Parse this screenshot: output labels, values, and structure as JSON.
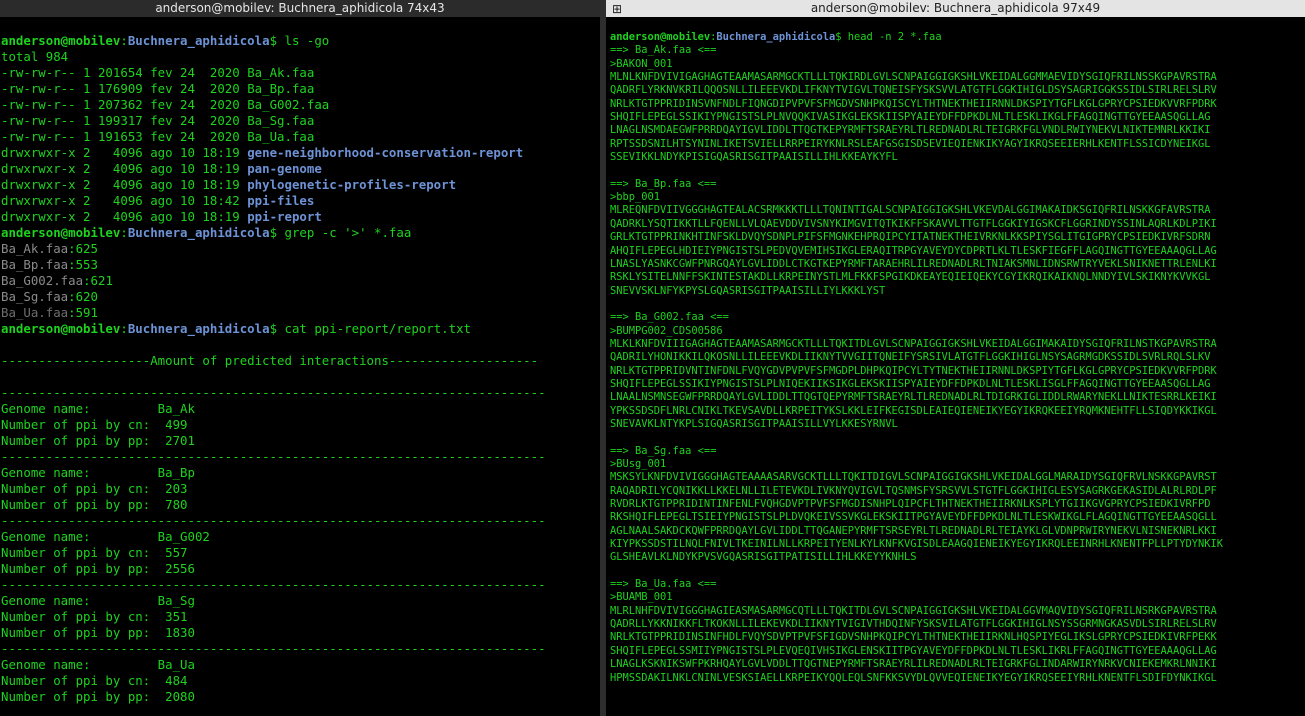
{
  "left_window": {
    "title": "anderson@mobilev: Buchnera_aphidicola 74x43",
    "prompt": {
      "user": "anderson@mobilev",
      "path": "Buchnera_aphidicola",
      "symbol": "$ "
    },
    "cmd1": "ls -go",
    "total": "total 984",
    "files": [
      {
        "meta": "-rw-rw-r-- 1 201654 fev 24  2020 ",
        "name": "Ba_Ak.faa"
      },
      {
        "meta": "-rw-rw-r-- 1 176909 fev 24  2020 ",
        "name": "Ba_Bp.faa"
      },
      {
        "meta": "-rw-rw-r-- 1 207362 fev 24  2020 ",
        "name": "Ba_G002.faa"
      },
      {
        "meta": "-rw-rw-r-- 1 199317 fev 24  2020 ",
        "name": "Ba_Sg.faa"
      },
      {
        "meta": "-rw-rw-r-- 1 191653 fev 24  2020 ",
        "name": "Ba_Ua.faa"
      }
    ],
    "dirs": [
      {
        "meta": "drwxrwxr-x 2   4096 ago 10 18:19 ",
        "name": "gene-neighborhood-conservation-report"
      },
      {
        "meta": "drwxrwxr-x 2   4096 ago 10 18:19 ",
        "name": "pan-genome"
      },
      {
        "meta": "drwxrwxr-x 2   4096 ago 10 18:19 ",
        "name": "phylogenetic-profiles-report"
      },
      {
        "meta": "drwxrwxr-x 2   4096 ago 10 18:42 ",
        "name": "ppi-files"
      },
      {
        "meta": "drwxrwxr-x 2   4096 ago 10 18:19 ",
        "name": "ppi-report"
      }
    ],
    "cmd2": "grep -c '>' *.faa",
    "counts": [
      {
        "file": "Ba_Ak.faa",
        "count": ":625"
      },
      {
        "file": "Ba_Bp.faa",
        "count": ":553"
      },
      {
        "file": "Ba_G002.faa",
        "count": ":621"
      },
      {
        "file": "Ba_Sg.faa",
        "count": ":620"
      },
      {
        "file": "Ba_Ua.faa",
        "count": ":591"
      }
    ],
    "cmd3": "cat ppi-report/report.txt",
    "report_header": "--------------------Amount of predicted interactions--------------------",
    "dash_rule": "-------------------------------------------------------------------------",
    "report": [
      {
        "genome_label": "Genome name:         ",
        "genome": "Ba_Ak",
        "cn_label": "Number of ppi by cn:  ",
        "cn": "499",
        "pp_label": "Number of ppi by pp:  ",
        "pp": "2701"
      },
      {
        "genome_label": "Genome name:         ",
        "genome": "Ba_Bp",
        "cn_label": "Number of ppi by cn:  ",
        "cn": "203",
        "pp_label": "Number of ppi by pp:  ",
        "pp": "780"
      },
      {
        "genome_label": "Genome name:         ",
        "genome": "Ba_G002",
        "cn_label": "Number of ppi by cn:  ",
        "cn": "557",
        "pp_label": "Number of ppi by pp:  ",
        "pp": "2556"
      },
      {
        "genome_label": "Genome name:         ",
        "genome": "Ba_Sg",
        "cn_label": "Number of ppi by cn:  ",
        "cn": "351",
        "pp_label": "Number of ppi by pp:  ",
        "pp": "1830"
      },
      {
        "genome_label": "Genome name:         ",
        "genome": "Ba_Ua",
        "cn_label": "Number of ppi by cn:  ",
        "cn": "484",
        "pp_label": "Number of ppi by pp:  ",
        "pp": "2080"
      }
    ]
  },
  "right_window": {
    "title": "anderson@mobilev: Buchnera_aphidicola 97x49",
    "icon": "terminal-icon",
    "prompt": {
      "user": "anderson@mobilev",
      "path": "Buchnera_aphidicola",
      "symbol": "$ "
    },
    "cmd": "head -n 2 *.faa",
    "blocks": [
      {
        "header": "==> Ba_Ak.faa <==",
        "id": ">BAKON_001",
        "seq": [
          "MLNLKNFDVIVIGAGHAGTEAAMASARMGCKTLLLTQKIRDLGVLSCNPAIGGIGKSHLVKEIDALGGMMAEVIDYSGIQFRILNSSKGPAVRSTRA",
          "QADRFLYRKNVKRILQQOSNLLILEEEVKDLIFKNYTVIGVLTQNEISFYSKSVVLATGTFLGGKIHIGLDSYSAGRIGGKSSIDLSIRLRELSLRV",
          "NRLKTGTPPRIDINSVNFNDLFIQNGDIPVPVFSFMGDVSNHPKQISCYLTHTNEKTHEIIRNNLDKSPIYTGFLKGLGPRYCPSIEDKVVRFPDRK",
          "SHQIFLEPEGLSSIKIYPNGISTSLPLNVQQKIVASIKGLEKSKIISPYAIEYDFFDPKDLNLTLESKLIKGLFFAGQINGTTGYEEAASQGLLAG",
          "LNAGLNSMDAEGWFPRRDQAYIGVLIDDLTTQGTKEPYRMFTSRAEYRLTLREDNADLRLTEIGRKFGLVNDLRWIYNEKVLNIKTEMNRLKKIKI",
          "RPTSSDSNILHTSYNINLIKETSVIELLRRPEIRYKNLRSLEAFGSGISDSEVIEQIENKIKYAGYIKRQSEEIERHLKENTFLSSICDYNEIKGL",
          "SSEVIKKLNDYKPISIGQASRISGITPAAISILLIHLKKEAYKYFL"
        ]
      },
      {
        "header": "==> Ba_Bp.faa <==",
        "id": ">bbp_001",
        "seq": [
          "MLREQNFDVIIVGGGHAGTEALACSRMKKKTLLLTQNINTIGALSCNPAIGGIGKSHLVKEVDALGGIMAKAIDKSGIQFRILNSKKGFAVRSTRA",
          "QADRKLYSQTIKKTLLFQENLLVLQAEVDDVIVSNYKIMGVITQTKIKFFSKAVVLTTGTFLGGKIYIGSKCFLGGRINDYSSINLAQRLKDLPIKI",
          "GRLKTGTPPRINKHTINFSKLDVQYSDNPLPIFSFMGNKEHPRQIPCYITATNEKTHEIVRKNLKKSPIYSGLITGIGPRYCPSIEDKIVRFSDRN",
          "AHQIFLEPEGLHDIEIYPNGISTSLPEDVQVEMIHSIKGLERAQITRPGYAVEYDYCDPRTLKLTLESKFIEGFFLAGQINGTTGYEEAAAQGLLAG",
          "LNASLYASNKCGWFPNRGQAYLGVLIDDLCTKGTKEPYRMFTARAEHRLILREDNADLRLTNIAKSMNLIDNSRWTRYVEKLSNIKNETTRLENLKI",
          "RSKLYSITELNNFFSKINTESTAKDLLKRPEINYSTLMLFKKFSPGIKDKEAYEQIEIQEKYCGYIKRQIKAIKNQLNNDYIVLSKIKNYKVVKGL",
          "SNEVVSKLNFYKPYSLGQASRISGITPAAISILLIYLKKKLYST"
        ]
      },
      {
        "header": "==> Ba_G002.faa <==",
        "id": ">BUMPG002_CDS00586",
        "seq": [
          "MLKLKNFDVIIIGAGHAGTEAAMASARMGCKTLLLTQKITDLGVLSCNPAIGGIGKSHLVKEIDALGGIMAKAIDYSGIQFRILNSTKGPAVRSTRA",
          "QADRILYHONIKKILQKOSNLLILEEEVKDLIIKNYTVVGIITQNEIFYSRSIVLATGTFLGGKIHIGLNSYSAGRMGDKSSIDLSVRLRQLSLKV",
          "NRLKTGTPPRIDVNTINFDNLFVQYGDVPVPVFSFMGDPLDHPKQIPCYLTYTNEKTHEIIRNNLDKSPIYTGFLKGLGPRYCPSIEDKVVRFPDRK",
          "SHQIFLEPEGLSSIKIYPNGISTSLPLNIQEKIIKSIKGLEKSKIISPYAIEYDFFDPKDLNLTLESKLISGLFFAGQINGTTGYEEAASQGLLAG",
          "LNAALNSMNSEGWFPRRDQAYLGVLIDDLTTQGTQEPYRMFTSRAEYRLTLREDNADLRLTDIGRKIGLIDDLRWARYNEKLLNIKTESRRLKEIKI",
          "YPKSSDSDFLNRLCNIKLTKEVSAVDLLKRPEITYKSLKKLEIFKEGISDLEAIEQIENEIKYEGYIKRQKEEIYRQMKNEHTFLLSIQDYKKIKGL",
          "SNEVAVKLNTYKPLSIGQASRISGITPAAISILLVYLKKESYRNVL"
        ]
      },
      {
        "header": "==> Ba_Sg.faa <==",
        "id": ">BUsg_001",
        "seq": [
          "MSKSYLKNFDVIVIGGGHAGTEAAAASARVGCKTLLLTQKITDIGVLSCNPAIGGIGKSHLVKEIDALGGLMARAIDYSGIQFRVLNSKKGPAVRST",
          "RAQADRILYCQNIKKLLKKELNLLILETEVKDLIVKNYQVIGVLTQSNMSFYSRSVVLSTGTFLGGKIHIGLESYSAGRKGEKASIDLALRLRDLPF",
          "RVDRLKTGTPPRIDINTINFENLFVQHGDVPTPVFSFMGDISNHPLQIPCFLTHTNEKTHEIIRKNLKSPLYTGIIKGVGPRYCPSIEDKIVRFPD",
          "RKSHQIFLEPEGLTSIEIYPNGISTSLPLDVQKEIVSSVKGLEKSKIITPGYAVEYDFFDPKDLNLTLESKWIKGLFLAGQINGTTGYEEAASQGLL",
          "AGLNAALSAKDCKQWFPRRDQAYLGVLIDDLTTQGANEPYRMFTSRSEYRLTLREDNADLRLTEIAYKLGLVDNPRWIRYNEKVLNISNEKNRLKKI",
          "KIYPKSSDSTILNQLFNIVLTKEINILNLLKRPEITYENLKYLKNFKVGISDLEAAGQIENEIKYEGYIKRQLEEINRHLKNENTFPLLPTYDYNKIK",
          "GLSHEAVLKLNDYKPVSVGQASRISGITPATISILLIHLKKEYYKNHLS"
        ]
      },
      {
        "header": "==> Ba_Ua.faa <==",
        "id": ">BUAMB_001",
        "seq": [
          "MLRLNHFDVIVIGGGHAGIEASMASARMGCQTLLLTQKITDLGVLSCNPAIGGIGKSHLVKEIDALGGVMAQVIDYSGIQFRILNSRKGPAVRSTRA",
          "QADRLLYKKNIKKFLTKOKNLLILEKEVKDLIIKNYTVIGIVTHDQINFYSKSVILATGTFLGGKIHIGLNSYSSGRMNGKASVDLSIRLRELSLRV",
          "NRLKTGTPPRIDINSINFHDLFVQYSDVPTPVFSFIGDVSNHPKQIPCYLTHTNEKTHEIIRKNLHQSPIYEGLIKSLGPRYCPSIEDKIVRFPEKK",
          "SHQIFLEPEGLSSMIIYPNGISTSLPLEVQEQIVHSIKGLENSKIITPGYAVEYDFFDPKDLNLTLESKLIKRLFFAGQINGTTGYEEAAAQGLLAG",
          "LNAGLKSKNIKSWFPKRHQAYLGVLVDDLTTQGTNEPYRMFTSRAEYRLILREDNADLRLTEIGRKFGLINDARWIRYNRKVCNIEKEMKRLNNIKI",
          "HPMSSDAKILNKLCNINLVESKSIAELLKRPEIKYQQLEQLSNFKKSVYDLQVVEQIENEIKYEGYIKRQSEEIYRHLKNENTFLSDIFDYNKIKGL"
        ]
      }
    ]
  }
}
